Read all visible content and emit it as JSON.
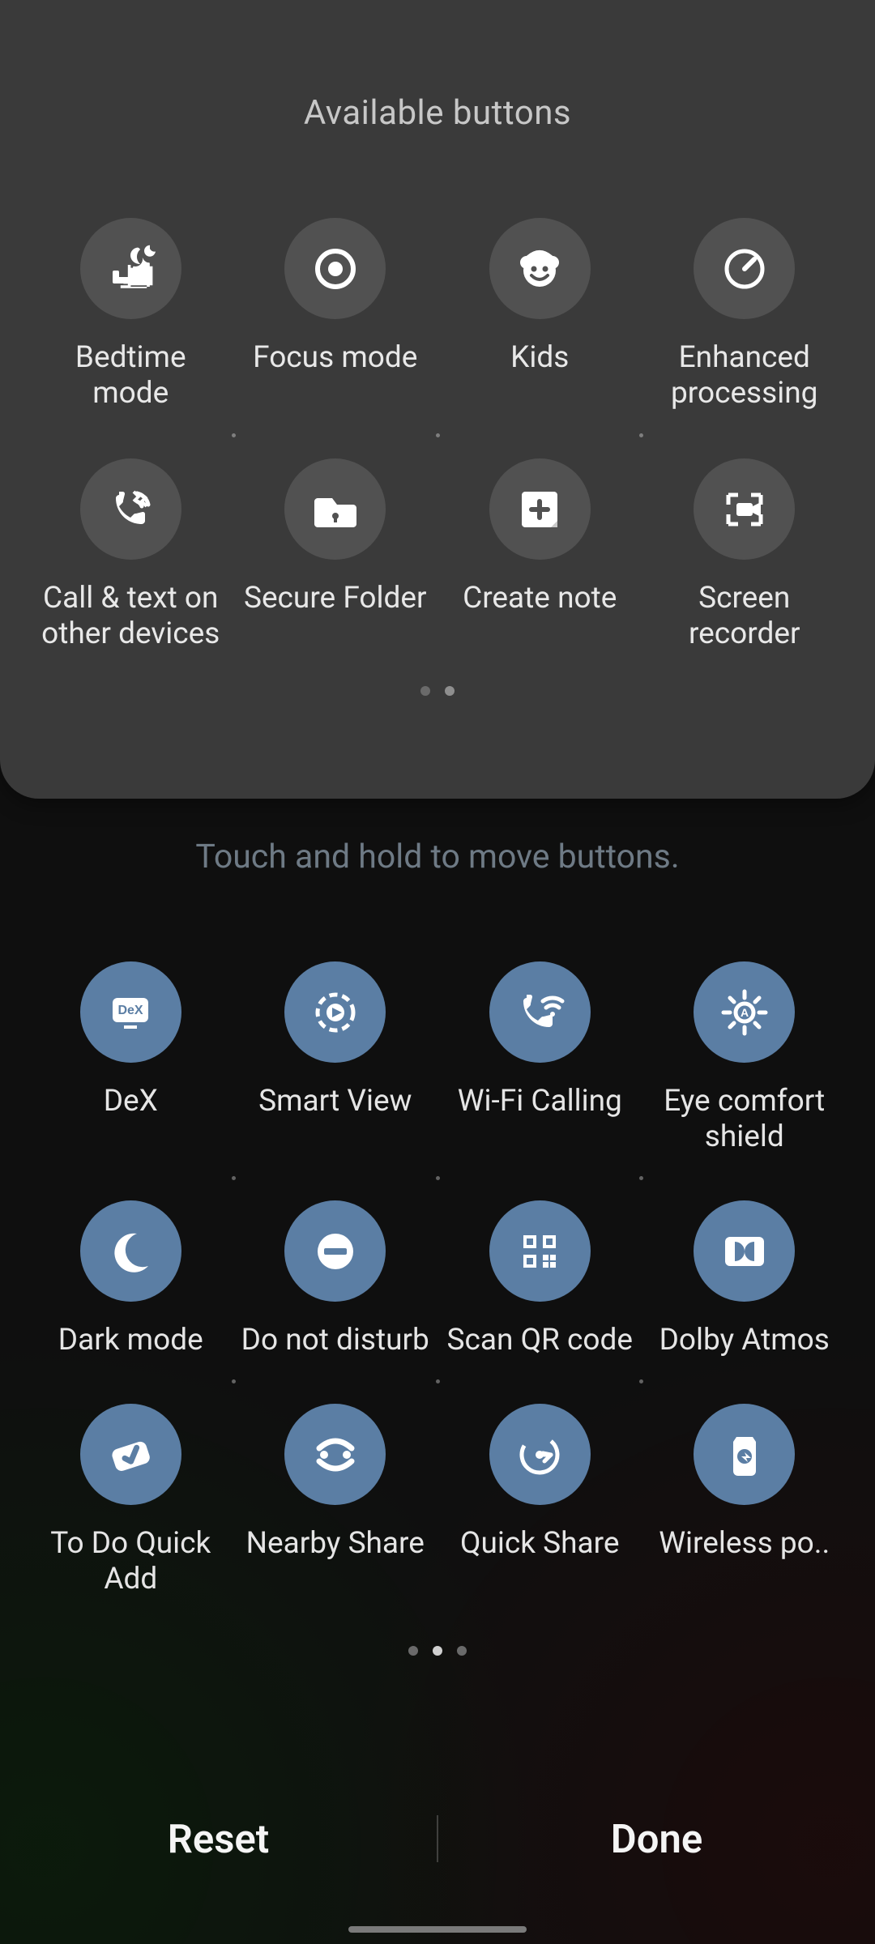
{
  "colors": {
    "available_tile": "#515151",
    "active_tile": "#5b7ea4"
  },
  "panel_title": "Available buttons",
  "available_page_index": 1,
  "available_page_count": 2,
  "available": [
    {
      "label": "Bedtime mode",
      "icon": "bedtime-mode"
    },
    {
      "label": "Focus mode",
      "icon": "focus-mode"
    },
    {
      "label": "Kids",
      "icon": "kids"
    },
    {
      "label": "Enhanced processing",
      "icon": "enhanced-processing"
    },
    {
      "label": "Call & text on other devices",
      "icon": "call-text-devices"
    },
    {
      "label": "Secure Folder",
      "icon": "secure-folder"
    },
    {
      "label": "Create note",
      "icon": "create-note"
    },
    {
      "label": "Screen recorder",
      "icon": "screen-recorder"
    }
  ],
  "hint": "Touch and hold to move buttons.",
  "active_page_index": 1,
  "active_page_count": 3,
  "active": [
    {
      "label": "DeX",
      "icon": "dex"
    },
    {
      "label": "Smart View",
      "icon": "smart-view"
    },
    {
      "label": "Wi-Fi Calling",
      "icon": "wifi-calling"
    },
    {
      "label": "Eye comfort shield",
      "icon": "eye-comfort-shield"
    },
    {
      "label": "Dark mode",
      "icon": "dark-mode"
    },
    {
      "label": "Do not disturb",
      "icon": "do-not-disturb"
    },
    {
      "label": "Scan QR code",
      "icon": "scan-qr-code"
    },
    {
      "label": "Dolby Atmos",
      "icon": "dolby-atmos"
    },
    {
      "label": "To Do Quick Add",
      "icon": "todo-quick-add"
    },
    {
      "label": "Nearby Share",
      "icon": "nearby-share"
    },
    {
      "label": "Quick Share",
      "icon": "quick-share"
    },
    {
      "label": "Wireless po..",
      "icon": "wireless-power-share",
      "truncate": true
    }
  ],
  "bottom": {
    "reset": "Reset",
    "done": "Done"
  }
}
